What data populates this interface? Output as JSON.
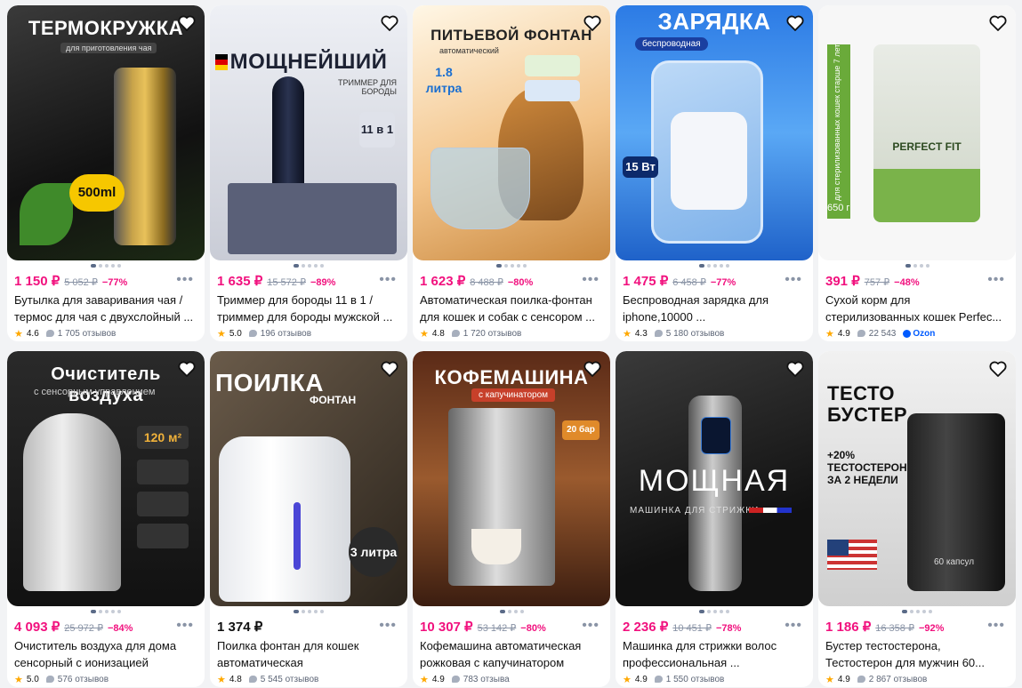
{
  "colors": {
    "accent": "#f1117e",
    "rating_star": "#ffa800",
    "brand": "#005bff"
  },
  "icons": {
    "favorite": "heart-outline-icon",
    "more": "ellipsis-icon",
    "star": "star-icon",
    "reviews": "chat-bubble-icon"
  },
  "products": [
    {
      "image_title": "ТЕРМОКРУЖКА",
      "image_subtitle": "для приготовления чая",
      "image_badge": "500ml",
      "price": "1 150 ₽",
      "old_price": "5 052 ₽",
      "discount": "−77%",
      "name": "Бутылка для заваривания чая / термос для чая с двухслойный ...",
      "rating": "4.6",
      "reviews": "1 705 отзывов"
    },
    {
      "image_title": "МОЩНЕЙШИЙ",
      "image_subtitle": "ТРИММЕР ДЛЯ БОРОДЫ",
      "image_badge": "11 в 1",
      "price": "1 635 ₽",
      "old_price": "15 572 ₽",
      "discount": "−89%",
      "name": "Триммер для бороды 11 в 1 / триммер для бороды мужской ...",
      "rating": "5.0",
      "reviews": "196 отзывов"
    },
    {
      "image_title": "ПИТЬЕВОЙ ФОНТАН",
      "image_subtitle": "автоматический",
      "image_badge": "1.8 литра",
      "price": "1 623 ₽",
      "old_price": "8 488 ₽",
      "discount": "−80%",
      "name": "Автоматическая поилка-фонтан для кошек и собак с сенсором ...",
      "rating": "4.8",
      "reviews": "1 720 отзывов"
    },
    {
      "image_title": "ЗАРЯДКА",
      "image_subtitle": "беспроводная",
      "image_badge": "15 Вт",
      "price": "1 475 ₽",
      "old_price": "6 458 ₽",
      "discount": "−77%",
      "name": "Беспроводная зарядка для iphone,10000 ...",
      "rating": "4.3",
      "reviews": "5 180 отзывов"
    },
    {
      "image_title": "PERFECT FIT",
      "image_subtitle": "для стерилизованных кошек старше 7 лет",
      "image_badge": "650 г",
      "price": "391 ₽",
      "old_price": "757 ₽",
      "discount": "−48%",
      "name": "Сухой корм для стерилизованных кошек Perfec...",
      "rating": "4.9",
      "reviews": "22 543",
      "seller": "Ozon"
    },
    {
      "image_title": "Очиститель воздуха",
      "image_subtitle": "с сенсорным управлением",
      "image_badge": "120 м²",
      "price": "4 093 ₽",
      "old_price": "25 972 ₽",
      "discount": "−84%",
      "name": "Очиститель воздуха для дома сенсорный с ионизацией",
      "rating": "5.0",
      "reviews": "576 отзывов"
    },
    {
      "image_title": "ПОИЛКА",
      "image_subtitle": "ФОНТАН",
      "image_badge": "3 литра",
      "price": "1 374 ₽",
      "old_price": "",
      "discount": "",
      "name": "Поилка фонтан для кошек автоматическая",
      "rating": "4.8",
      "reviews": "5 545 отзывов"
    },
    {
      "image_title": "КОФЕМАШИНА",
      "image_subtitle": "с капучинатором",
      "image_badge": "20 бар",
      "price": "10 307 ₽",
      "old_price": "53 142 ₽",
      "discount": "−80%",
      "name": "Кофемашина автоматическая рожковая с капучинатором",
      "rating": "4.9",
      "reviews": "783 отзыва"
    },
    {
      "image_title": "МОЩНАЯ",
      "image_subtitle": "МАШИНКА ДЛЯ СТРИЖКИ",
      "image_badge": "",
      "price": "2 236 ₽",
      "old_price": "10 451 ₽",
      "discount": "−78%",
      "name": "Машинка для стрижки волос профессиональная ...",
      "rating": "4.9",
      "reviews": "1 550 отзывов"
    },
    {
      "image_title": "ТЕСТО БУСТЕР",
      "image_subtitle": "+20% ТЕСТОСТЕРОНА ЗА 2 НЕДЕЛИ",
      "image_badge": "60 капсул",
      "price": "1 186 ₽",
      "old_price": "16 358 ₽",
      "discount": "−92%",
      "name": "Бустер тестостерона, Тестостерон для мужчин 60...",
      "rating": "4.9",
      "reviews": "2 867 отзывов"
    }
  ]
}
